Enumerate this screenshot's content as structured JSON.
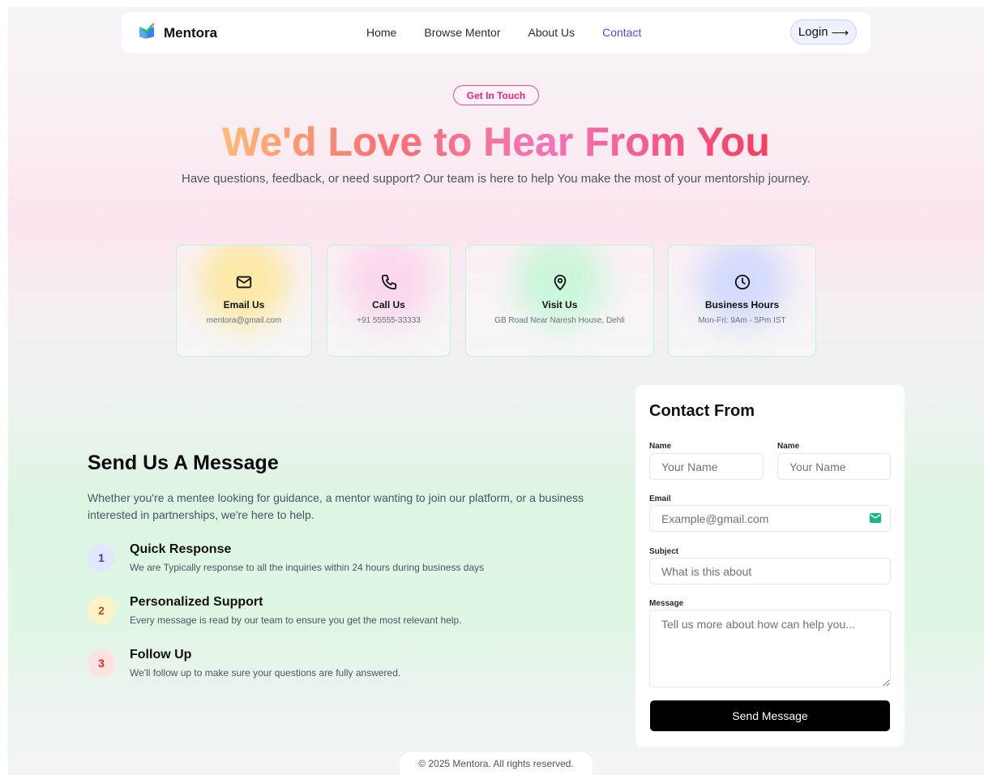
{
  "brand": {
    "name": "Mentora"
  },
  "nav": {
    "items": [
      {
        "label": "Home"
      },
      {
        "label": "Browse Mentor"
      },
      {
        "label": "About Us"
      },
      {
        "label": "Contact",
        "active": true
      }
    ],
    "login_label": "Login",
    "login_arrow": "⟶"
  },
  "hero": {
    "badge": "Get In Touch",
    "title": "We'd Love to Hear From You",
    "subtitle": "Have questions, feedback, or need support? Our team is here to help You make the most of your mentorship journey."
  },
  "cards": [
    {
      "icon": "mail-icon",
      "title": "Email Us",
      "value": "mentora@gmail.com",
      "glow": "#fde68a"
    },
    {
      "icon": "phone-icon",
      "title": "Call Us",
      "value": "+91 55555-33333",
      "glow": "#fbcfe8"
    },
    {
      "icon": "map-pin-icon",
      "title": "Visit Us",
      "value": "GB Road Near Naresh House, Dehli",
      "glow": "#bbf7d0"
    },
    {
      "icon": "clock-icon",
      "title": "Business Hours",
      "value": "Mon-Fri: 9Am - 5Pm IST",
      "glow": "#c7d2fe"
    }
  ],
  "message_section": {
    "title": "Send Us A Message",
    "description": "Whether you're a mentee looking for guidance, a mentor wanting to join our platform, or a business interested in partnerships, we're here to help.",
    "features": [
      {
        "number": "1",
        "title": "Quick Response",
        "desc": "We are Typically response to all the inquiries within 24 hours during business days",
        "bg": "#e0e7ff",
        "color": "#4338ca"
      },
      {
        "number": "2",
        "title": "Personalized Support",
        "desc": "Every message is read by our team to ensure you get the most relevant help.",
        "bg": "#fef3c7",
        "color": "#b45309"
      },
      {
        "number": "3",
        "title": "Follow Up",
        "desc": "We'll follow up to make sure your questions are fully answered.",
        "bg": "#fee2e2",
        "color": "#dc2626"
      }
    ]
  },
  "form": {
    "title": "Contact From",
    "name1_label": "Name",
    "name1_placeholder": "Your Name",
    "name2_label": "Name",
    "name2_placeholder": "Your Name",
    "email_label": "Email",
    "email_placeholder": "Example@gmail.com",
    "subject_label": "Subject",
    "subject_placeholder": "What is this about",
    "message_label": "Message",
    "message_placeholder": "Tell us more about how can help you...",
    "submit_label": "Send Message"
  },
  "footer": {
    "text": "© 2025 Mentora. All rights reserved."
  },
  "colors": {
    "accent": "#4f46e5",
    "badge": "#db2777",
    "button": "#000000"
  }
}
